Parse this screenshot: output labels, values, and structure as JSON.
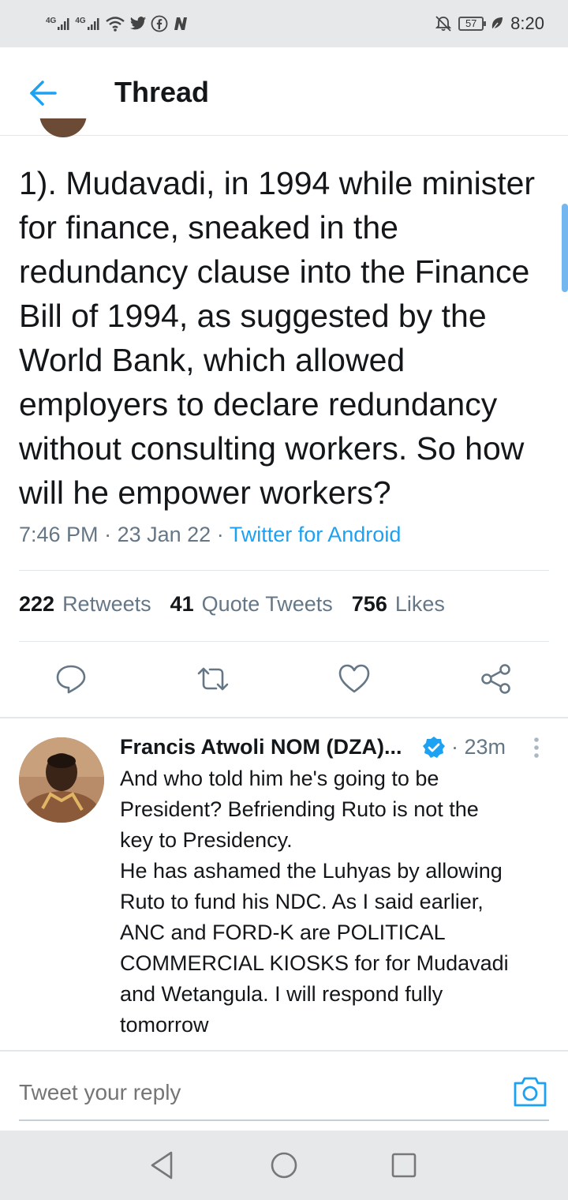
{
  "status_bar": {
    "signal1_label": "4G",
    "signal2_label": "4G",
    "icons": [
      "wifi-icon",
      "twitter-icon",
      "facebook-icon",
      "n-app-icon",
      "mute-icon",
      "leaf-icon"
    ],
    "battery": "57",
    "time": "8:20"
  },
  "header": {
    "title": "Thread"
  },
  "tweet": {
    "text": "1). Mudavadi, in 1994 while minister for finance, sneaked in the redundancy clause into the Finance Bill of 1994, as suggested by the World Bank, which allowed employers to declare redundancy without consulting workers. So how will he empower workers?",
    "time": "7:46 PM",
    "date": "23 Jan 22",
    "separator": "·",
    "source": "Twitter for Android"
  },
  "stats": {
    "retweets_count": "222",
    "retweets_label": "Retweets",
    "quotes_count": "41",
    "quotes_label": "Quote Tweets",
    "likes_count": "756",
    "likes_label": "Likes"
  },
  "actions": [
    "reply-icon",
    "retweet-icon",
    "like-icon",
    "share-icon"
  ],
  "reply": {
    "name": "Francis Atwoli NOM (DZA)...",
    "time": "· 23m",
    "text_lines": [
      "And who told him he's going to be",
      "President? Befriending Ruto is not the",
      "key to Presidency.",
      "He has ashamed the Luhyas by allowing",
      "Ruto to fund his NDC. As I said earlier,",
      "ANC and FORD-K are POLITICAL",
      "COMMERCIAL KIOSKS for for Mudavadi",
      "and Wetangula. I will respond fully",
      "tomorrow"
    ]
  },
  "composer": {
    "placeholder": "Tweet your reply"
  },
  "colors": {
    "accent": "#1da1f2",
    "text": "#14171a",
    "muted": "#657786",
    "divider": "#e1e8ed",
    "system_bar": "#e7e8ea"
  }
}
